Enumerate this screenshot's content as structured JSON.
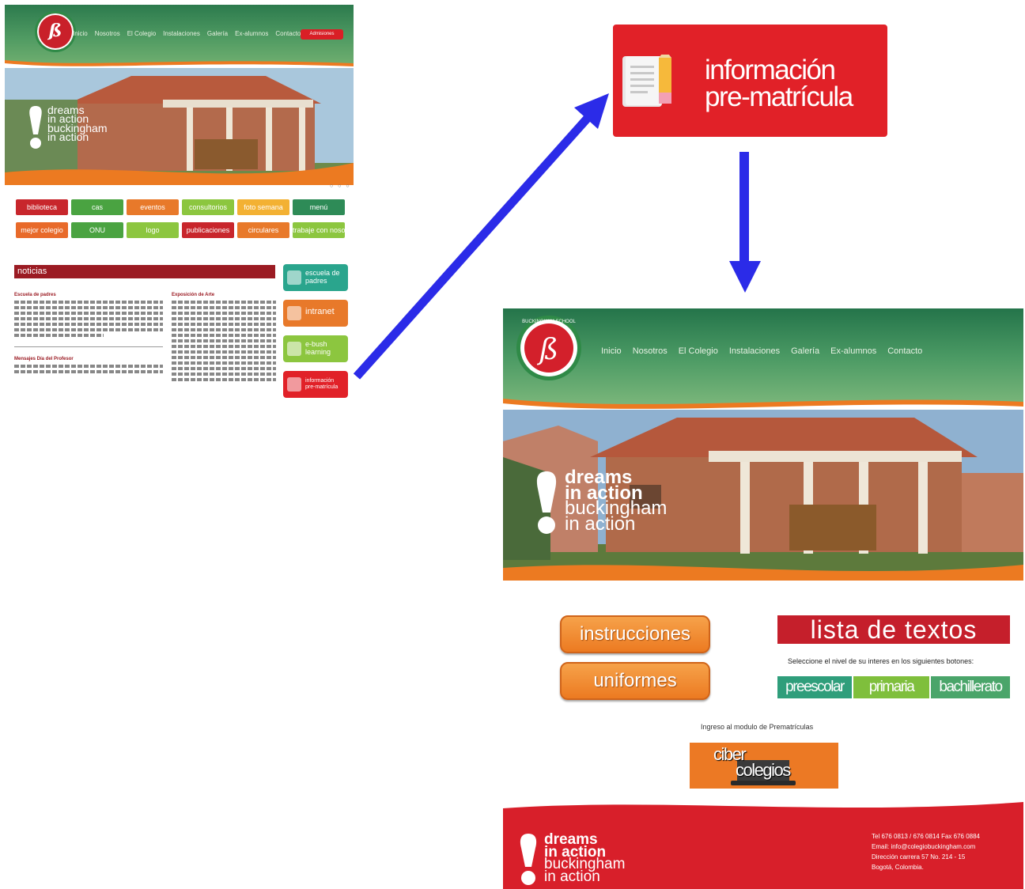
{
  "small_page": {
    "logo_letters": "ß",
    "nav": [
      "Inicio",
      "Nosotros",
      "El Colegio",
      "Instalaciones",
      "Galería",
      "Ex-alumnos",
      "Contacto"
    ],
    "admissions_button": "Admisiones",
    "slogan": [
      "dreams",
      "in action",
      "buckingham",
      "in action"
    ],
    "slider_dots": "○ ○ ○",
    "tiles": [
      {
        "label": "biblioteca",
        "color": "#c8262c"
      },
      {
        "label": "cas",
        "color": "#4aa341"
      },
      {
        "label": "eventos",
        "color": "#e8792a"
      },
      {
        "label": "consultorios",
        "color": "#8cc63f"
      },
      {
        "label": "foto semana",
        "color": "#f3b133"
      },
      {
        "label": "menú",
        "color": "#2e8b57"
      },
      {
        "label": "mejor colegio",
        "color": "#e86a2a"
      },
      {
        "label": "ONU",
        "color": "#4aa341"
      },
      {
        "label": "logo",
        "color": "#8cc63f"
      },
      {
        "label": "publicaciones",
        "color": "#c8262c"
      },
      {
        "label": "circulares",
        "color": "#e8792a"
      },
      {
        "label": "trabaje con nosotros",
        "color": "#8cc63f"
      }
    ],
    "news_header": "noticias",
    "news": [
      {
        "title": "Escuela de padres"
      },
      {
        "title": "Exposición de Arte"
      },
      {
        "title": "Mensajes Día del Profesor"
      }
    ],
    "side_buttons": [
      {
        "line1": "escuela de",
        "line2": "padres",
        "color": "#2aa58d"
      },
      {
        "line1": "intranet",
        "line2": "",
        "color": "#e8792a"
      },
      {
        "line1": "e-bush",
        "line2": "learning",
        "color": "#8cc63f"
      },
      {
        "line1": "información",
        "line2": "pre-matrícula",
        "color": "#e12128"
      }
    ]
  },
  "badge": {
    "line1": "información",
    "line2": "pre-matrícula"
  },
  "big_page": {
    "logo_ring_text": "BUCKINGHAM SCHOOL",
    "logo_letters": "ß",
    "nav": [
      "Inicio",
      "Nosotros",
      "El Colegio",
      "Instalaciones",
      "Galería",
      "Ex-alumnos",
      "Contacto"
    ],
    "slogan": [
      "dreams",
      "in action",
      "buckingham",
      "in action"
    ],
    "instrucciones": "instrucciones",
    "uniformes": "uniformes",
    "lista_de_textos": "lista de textos",
    "select_text": "Seleccione el nivel de su interes en los siguientes botones:",
    "levels": [
      {
        "label": "preescolar",
        "color": "#2f9e7b"
      },
      {
        "label": "primaria",
        "color": "#7fbf3c"
      },
      {
        "label": "bachillerato",
        "color": "#4aa56a"
      }
    ],
    "ingreso_text": "Ingreso al modulo de Prematrículas",
    "ciber_line1": "ciber",
    "ciber_line2": "colegios",
    "footer": {
      "slogan": [
        "dreams",
        "in action",
        "buckingham",
        "in action"
      ],
      "contact": [
        "Tel 676 0813 / 676 0814  Fax 676 0884",
        "Email: info@colegiobuckingham.com",
        "Dirección carrera 57 No. 214 - 15",
        "Bogotá, Colombia."
      ]
    }
  },
  "colors": {
    "arrow": "#2b2be8",
    "green_header": "#2f7d4f",
    "orange": "#ec7a21",
    "red": "#e12128"
  }
}
